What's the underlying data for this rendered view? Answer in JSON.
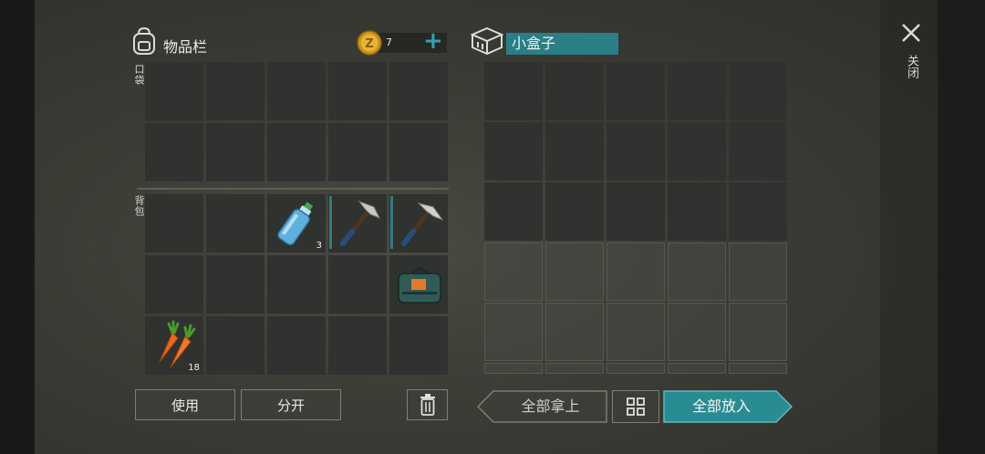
{
  "inventory": {
    "title": "物品栏",
    "pocket_label": "口袋",
    "backpack_label": "背包"
  },
  "currency": {
    "amount": "7",
    "add_symbol": "+"
  },
  "container": {
    "name": "小盒子"
  },
  "items": {
    "water_bottle_qty": "3",
    "carrot_qty": "18"
  },
  "buttons": {
    "use": "使用",
    "split": "分开",
    "take_all": "全部拿上",
    "put_all": "全部放入"
  },
  "close": {
    "label": "关闭"
  },
  "colors": {
    "accent": "#2a8c93",
    "slot": "#2f322e"
  }
}
